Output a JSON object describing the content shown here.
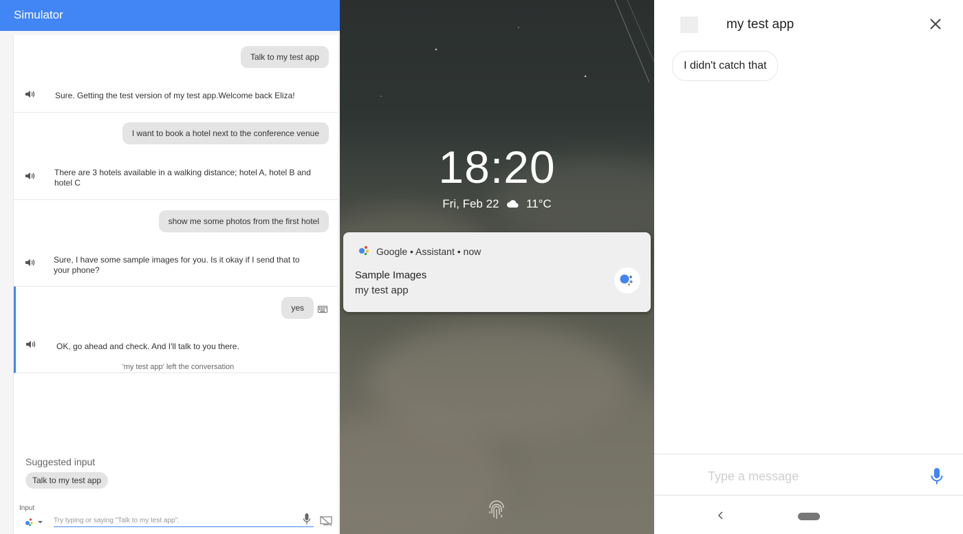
{
  "simulator": {
    "title": "Simulator",
    "turns": [
      {
        "user": "Talk to my test app",
        "reply": "Sure. Getting the test version of my test app.Welcome back Eliza!"
      },
      {
        "user": "I want to book a hotel next to the conference venue",
        "reply": "There are 3 hotels available in a walking distance; hotel A, hotel B and hotel C"
      },
      {
        "user": "show me some photos from the first hotel",
        "reply": "Sure, I have some sample images for you. Is it okay if I send that to your phone?"
      },
      {
        "user": "yes",
        "reply": "OK, go ahead and check. And I'll talk to you there.",
        "note": "'my test app' left the conversation"
      }
    ],
    "suggested_label": "Suggested input",
    "suggested_chip": "Talk to my test app",
    "input_label": "Input",
    "input_placeholder": "Try typing or saying \"Talk to my test app\"."
  },
  "phone": {
    "time": "18:20",
    "date": "Fri, Feb 22",
    "temperature": "11°C",
    "notification": {
      "header": "Google • Assistant • now",
      "title": "Sample Images",
      "subtitle": "my test app"
    }
  },
  "chat": {
    "app_title": "my test app",
    "bot_message": "I didn't catch that",
    "input_placeholder": "Type a message"
  },
  "colors": {
    "accent": "#4285f4",
    "bubble": "#e4e4e4"
  }
}
